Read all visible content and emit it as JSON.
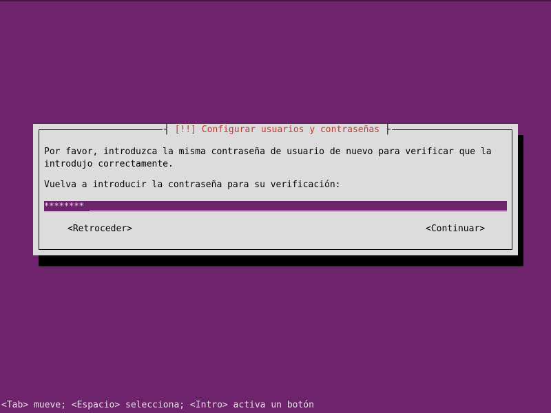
{
  "dialog": {
    "title_open": "[!!]",
    "title": "Configurar usuarios y contraseñas",
    "bracket_left": "┤",
    "bracket_right": "├",
    "prompt": "Por favor, introduzca la misma contraseña de usuario de nuevo para verificar que la\nintrodujo correctamente.",
    "field_label": "Vuelva a introducir la contraseña para su verificación:",
    "password_value": "********",
    "buttons": {
      "back": "<Retroceder>",
      "continue": "<Continuar>"
    }
  },
  "statusbar": {
    "text": "<Tab> mueve; <Espacio> selecciona; <Intro> activa un botón"
  },
  "colors": {
    "background": "#6e246c",
    "dialog": "#dcdcdc",
    "title": "#c0392b",
    "shadow": "#000000"
  }
}
